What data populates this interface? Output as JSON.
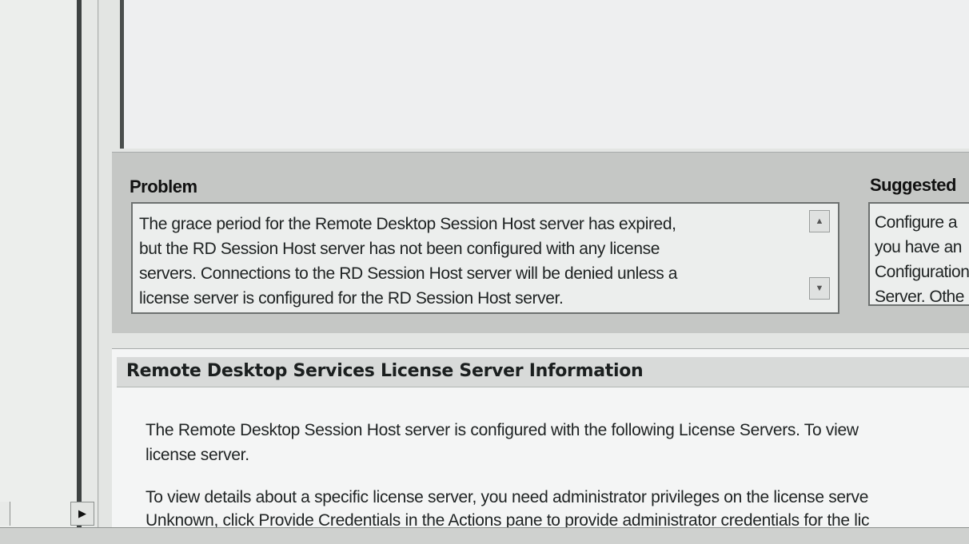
{
  "problem": {
    "heading": "Problem",
    "lines": [
      "The grace period for the Remote Desktop Session Host server has expired,",
      "but the RD Session Host server has not been configured with any license",
      "servers. Connections to the RD Session Host server will be denied unless a",
      "license server is configured for the RD Session Host server."
    ]
  },
  "suggested": {
    "heading": "Suggested",
    "lines": [
      "Configure a",
      "you have an",
      "Configuration",
      "Server. Othe"
    ]
  },
  "info": {
    "title": "Remote Desktop Services License Server Information",
    "para1_line1": "The Remote Desktop Session Host server is configured with the following License Servers. To view",
    "para1_line2": "license server.",
    "para2_line1": "To view details about a specific license server, you need administrator privileges on the license serve",
    "para2_line2": "Unknown, click Provide Credentials in the Actions pane to provide administrator credentials for the lic"
  },
  "icons": {
    "scroll_up": "scroll-up-arrow-icon",
    "scroll_down": "scroll-down-arrow-icon",
    "scroll_right": "scroll-right-arrow-icon"
  }
}
